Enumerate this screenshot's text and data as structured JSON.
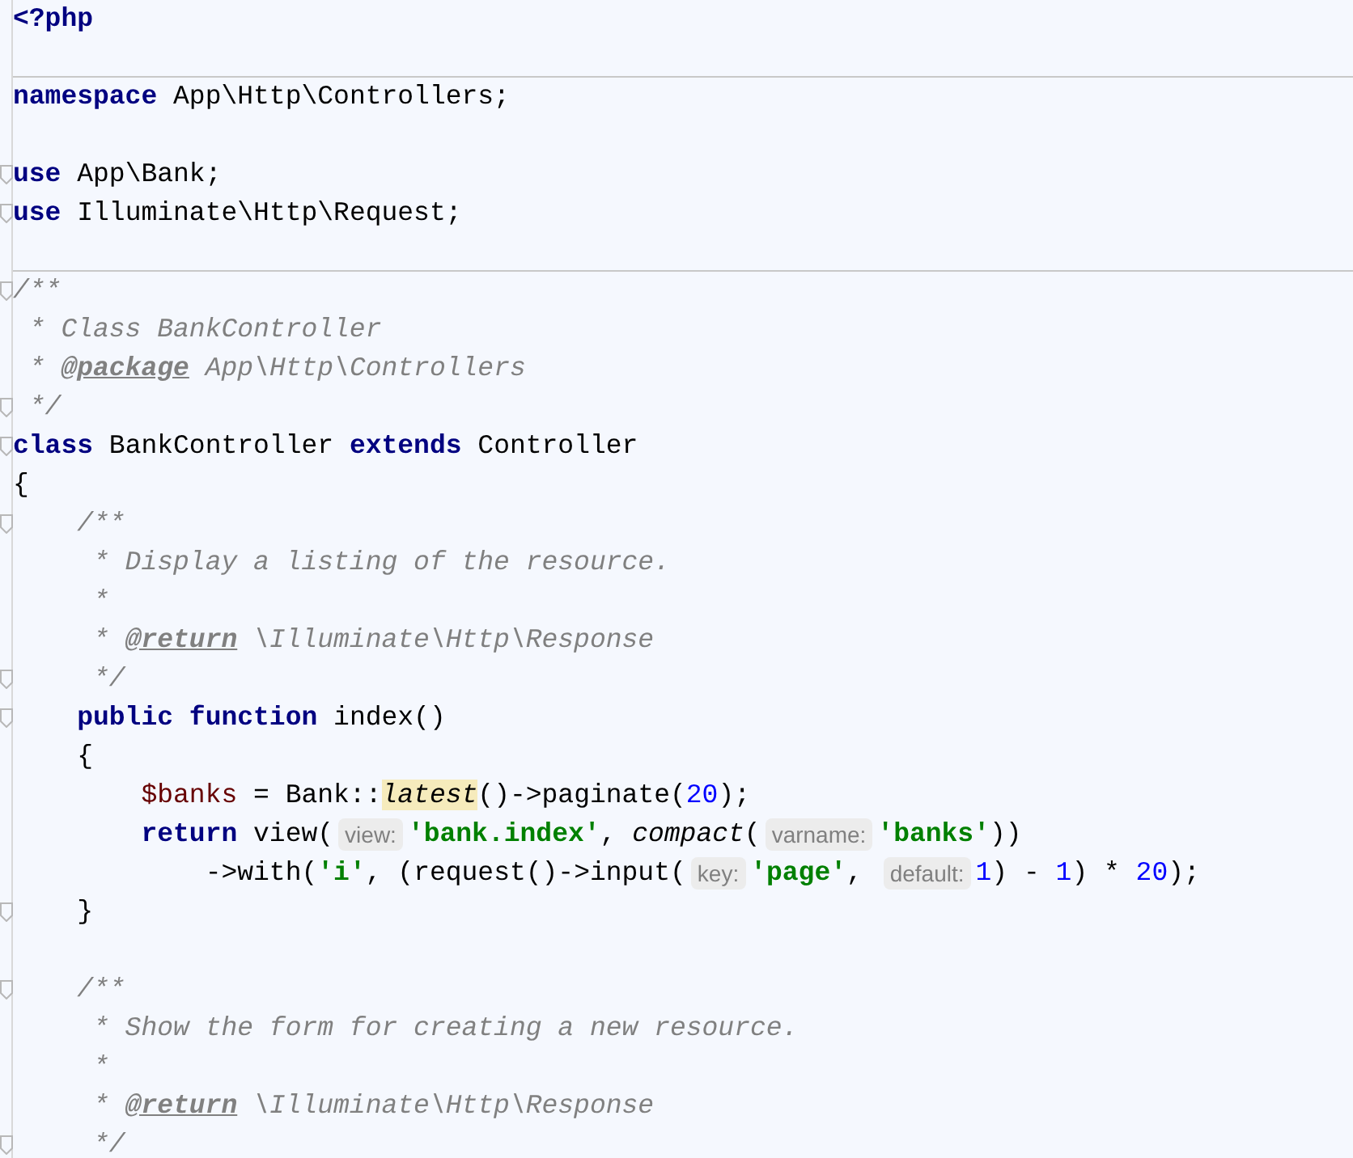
{
  "editor": {
    "lines": [
      {
        "tokens": [
          {
            "kind": "keyword",
            "text": "<?php"
          }
        ]
      },
      {
        "kind": "blank",
        "separator_below": true
      },
      {
        "tokens": [
          {
            "kind": "keyword",
            "text": "namespace"
          },
          {
            "kind": "plain",
            "text": " App\\Http\\Controllers;"
          }
        ]
      },
      {
        "kind": "blank"
      },
      {
        "fold": true,
        "tokens": [
          {
            "kind": "keyword",
            "text": "use"
          },
          {
            "kind": "plain",
            "text": " App\\Bank;"
          }
        ]
      },
      {
        "fold": true,
        "tokens": [
          {
            "kind": "keyword",
            "text": "use"
          },
          {
            "kind": "plain",
            "text": " Illuminate\\Http\\Request;"
          }
        ]
      },
      {
        "kind": "blank",
        "separator_below": true
      },
      {
        "fold": true,
        "tokens": [
          {
            "kind": "comment",
            "text": "/**"
          }
        ]
      },
      {
        "tokens": [
          {
            "kind": "comment",
            "text": " * Class BankController"
          }
        ]
      },
      {
        "tokens": [
          {
            "kind": "comment",
            "text": " * "
          },
          {
            "kind": "doctag",
            "text": "@package"
          },
          {
            "kind": "comment",
            "text": " App\\Http\\Controllers"
          }
        ]
      },
      {
        "fold": true,
        "tokens": [
          {
            "kind": "comment",
            "text": " */"
          }
        ]
      },
      {
        "fold": true,
        "tokens": [
          {
            "kind": "keyword",
            "text": "class"
          },
          {
            "kind": "plain",
            "text": " BankController "
          },
          {
            "kind": "keyword",
            "text": "extends"
          },
          {
            "kind": "plain",
            "text": " Controller"
          }
        ]
      },
      {
        "tokens": [
          {
            "kind": "plain",
            "text": "{"
          }
        ]
      },
      {
        "fold": true,
        "tokens": [
          {
            "kind": "comment",
            "text": "    /**"
          }
        ]
      },
      {
        "tokens": [
          {
            "kind": "comment",
            "text": "     * Display a listing of the resource."
          }
        ]
      },
      {
        "tokens": [
          {
            "kind": "comment",
            "text": "     *"
          }
        ]
      },
      {
        "tokens": [
          {
            "kind": "comment",
            "text": "     * "
          },
          {
            "kind": "doctag",
            "text": "@return"
          },
          {
            "kind": "comment",
            "text": " \\Illuminate\\Http\\Response"
          }
        ]
      },
      {
        "fold": true,
        "tokens": [
          {
            "kind": "comment",
            "text": "     */"
          }
        ]
      },
      {
        "fold": true,
        "tokens": [
          {
            "kind": "keyword",
            "text": "    public function"
          },
          {
            "kind": "plain",
            "text": " index()"
          }
        ]
      },
      {
        "tokens": [
          {
            "kind": "plain",
            "text": "    {"
          }
        ]
      },
      {
        "tokens": [
          {
            "kind": "variable",
            "text": "        $banks"
          },
          {
            "kind": "plain",
            "text": " = Bank::"
          },
          {
            "kind": "highlight",
            "text": "latest"
          },
          {
            "kind": "plain",
            "text": "()->paginate("
          },
          {
            "kind": "number",
            "text": "20"
          },
          {
            "kind": "plain",
            "text": ");"
          }
        ]
      },
      {
        "tokens": [
          {
            "kind": "keyword",
            "text": "        return"
          },
          {
            "kind": "plain",
            "text": " view("
          },
          {
            "kind": "hint",
            "text": "view:"
          },
          {
            "kind": "string",
            "text": "'bank.index'"
          },
          {
            "kind": "plain",
            "text": ", "
          },
          {
            "kind": "call",
            "text": "compact"
          },
          {
            "kind": "plain",
            "text": "("
          },
          {
            "kind": "hint",
            "text": "varname:"
          },
          {
            "kind": "string",
            "text": "'banks'"
          },
          {
            "kind": "plain",
            "text": "))"
          }
        ]
      },
      {
        "tokens": [
          {
            "kind": "plain",
            "text": "            ->with("
          },
          {
            "kind": "string",
            "text": "'i'"
          },
          {
            "kind": "plain",
            "text": ", (request()->input("
          },
          {
            "kind": "hint",
            "text": "key:"
          },
          {
            "kind": "string",
            "text": "'page'"
          },
          {
            "kind": "plain",
            "text": ", "
          },
          {
            "kind": "hint",
            "text": "default:"
          },
          {
            "kind": "number",
            "text": "1"
          },
          {
            "kind": "plain",
            "text": ") - "
          },
          {
            "kind": "number",
            "text": "1"
          },
          {
            "kind": "plain",
            "text": ") * "
          },
          {
            "kind": "number",
            "text": "20"
          },
          {
            "kind": "plain",
            "text": ");"
          }
        ]
      },
      {
        "fold": true,
        "tokens": [
          {
            "kind": "plain",
            "text": "    }"
          }
        ]
      },
      {
        "kind": "blank"
      },
      {
        "fold": true,
        "tokens": [
          {
            "kind": "comment",
            "text": "    /**"
          }
        ]
      },
      {
        "tokens": [
          {
            "kind": "comment",
            "text": "     * Show the form for creating a new resource."
          }
        ]
      },
      {
        "tokens": [
          {
            "kind": "comment",
            "text": "     *"
          }
        ]
      },
      {
        "tokens": [
          {
            "kind": "comment",
            "text": "     * "
          },
          {
            "kind": "doctag",
            "text": "@return"
          },
          {
            "kind": "comment",
            "text": " \\Illuminate\\Http\\Response"
          }
        ]
      },
      {
        "fold": true,
        "tokens": [
          {
            "kind": "comment",
            "text": "     */"
          }
        ]
      }
    ]
  }
}
